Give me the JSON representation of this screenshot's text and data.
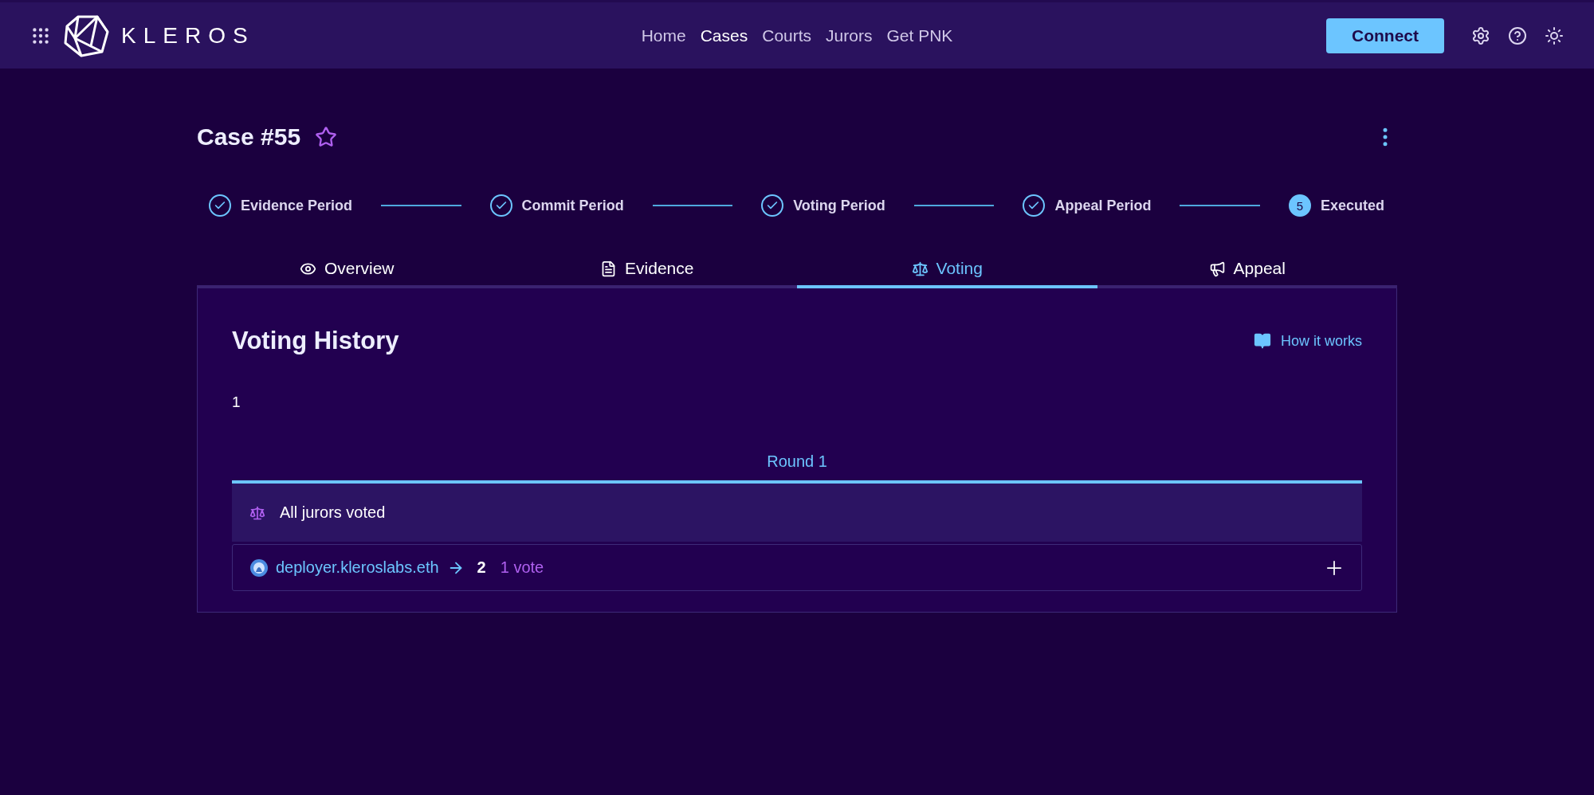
{
  "header": {
    "logo": "KLEROS",
    "nav": [
      {
        "label": "Home",
        "selected": false
      },
      {
        "label": "Cases",
        "selected": true
      },
      {
        "label": "Courts",
        "selected": false
      },
      {
        "label": "Jurors",
        "selected": false
      },
      {
        "label": "Get PNK",
        "selected": false
      }
    ],
    "connect": "Connect"
  },
  "case": {
    "title": "Case #55",
    "starred": false
  },
  "steps": [
    {
      "label": "Evidence Period",
      "completed": true
    },
    {
      "label": "Commit Period",
      "completed": true
    },
    {
      "label": "Voting Period",
      "completed": true
    },
    {
      "label": "Appeal Period",
      "completed": true
    },
    {
      "label": "Executed",
      "completed": false,
      "number": "5"
    }
  ],
  "tabs": [
    {
      "label": "Overview",
      "selected": false
    },
    {
      "label": "Evidence",
      "selected": false
    },
    {
      "label": "Voting",
      "selected": true
    },
    {
      "label": "Appeal",
      "selected": false
    }
  ],
  "panel": {
    "title": "Voting History",
    "help": "How it works",
    "count": "1",
    "rounds": [
      {
        "label": "Round 1",
        "selected": true
      }
    ],
    "status": "All jurors voted",
    "votes": [
      {
        "juror": "deployer.kleroslabs.eth",
        "choice": "2",
        "weight": "1 vote",
        "expanded": false
      }
    ]
  }
}
